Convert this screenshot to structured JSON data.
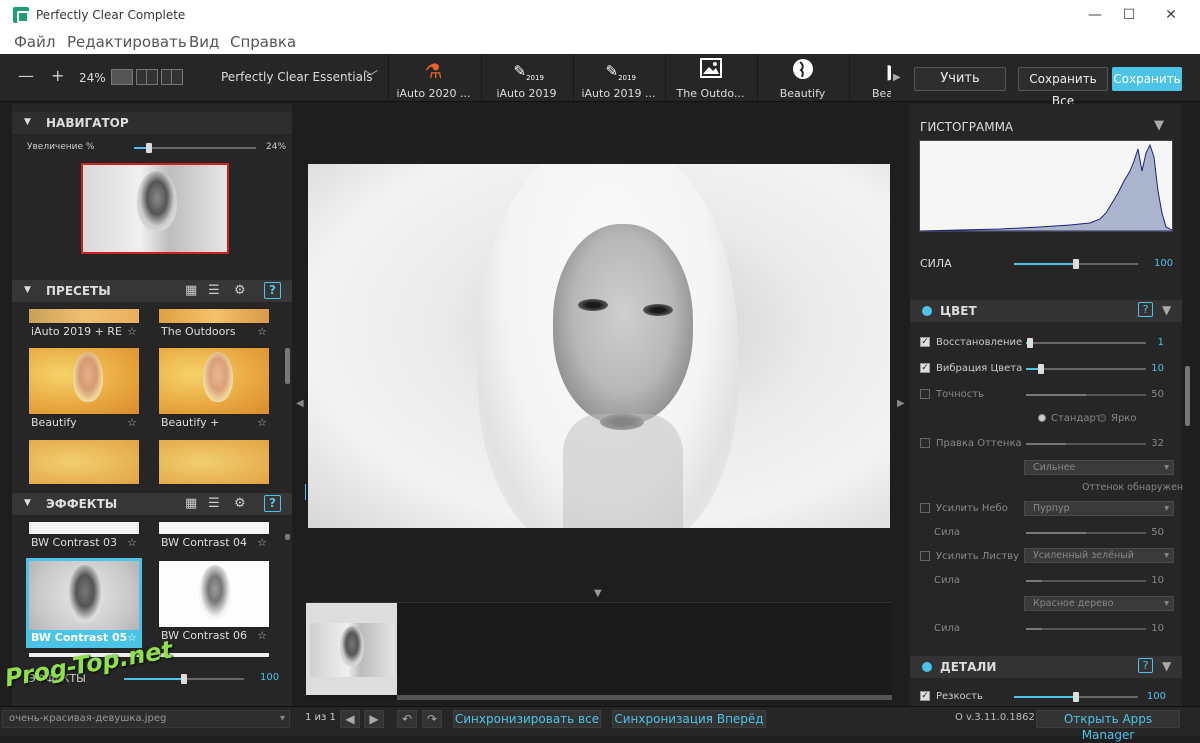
{
  "window": {
    "title": "Perfectly Clear Complete"
  },
  "menu": [
    "Файл",
    "Редактировать",
    "Вид",
    "Справка"
  ],
  "toolbar": {
    "zoom": "24%",
    "preset_group": "Perfectly Clear Essentials",
    "preset_tabs": [
      "iAuto 2020 ...",
      "iAuto 2019",
      "iAuto 2019 ...",
      "The Outdo...",
      "Beautify",
      "Beau"
    ],
    "tab_badge": "2019",
    "learn": "Учить",
    "save_all": "Сохранить Все",
    "save": "Сохранить"
  },
  "navigator": {
    "title": "НАВИГАТОР",
    "zoom_label": "Увеличение %",
    "zoom_value": "24%",
    "zoom_fraction": 0.12
  },
  "presets": {
    "title": "ПРЕСЕТЫ",
    "items": [
      "iAuto 2019 + RE",
      "The Outdoors",
      "Beautify",
      "Beautify +"
    ]
  },
  "effects": {
    "title": "ЭФФЕКТЫ",
    "items": [
      "BW Contrast 03",
      "BW Contrast 04",
      "BW Contrast 05",
      "BW Contrast 06"
    ],
    "strength_label": "ЭФФЕКТЫ",
    "strength_value": "100",
    "strength_fraction": 0.5
  },
  "histogram": {
    "title": "ГИСТОГРАММА",
    "strength_label": "СИЛА",
    "strength_value": "100",
    "strength_fraction": 0.5
  },
  "color": {
    "title": "ЦВЕТ",
    "restore_label": "Восстановление",
    "restore_value": "1",
    "vibrance_label": "Вибрация Цвета",
    "vibrance_value": "10",
    "accuracy_label": "Точность",
    "accuracy_value": "50",
    "radio_standard": "Стандарт",
    "radio_bright": "Ярко",
    "tint_label": "Правка Оттенка",
    "tint_value": "32",
    "tint_dd": "Сильнее",
    "tint_detected": "Оттенок обнаружен",
    "sky_label": "Усилить Небо",
    "sky_dd": "Пурпур",
    "sky_strength_label": "Сила",
    "sky_strength_value": "50",
    "foliage_label": "Усилить Листву",
    "foliage_dd": "Усиленный зелёный",
    "foliage_strength_label": "Сила",
    "foliage_strength_value": "10",
    "wood_dd": "Красное дерево",
    "wood_strength_label": "Сила",
    "wood_strength_value": "10"
  },
  "details": {
    "title": "ДЕТАЛИ",
    "sharpness_label": "Резкость",
    "sharpness_value": "100"
  },
  "status": {
    "filename": "очень-красивая-девушка.jpeg",
    "page": "1 из 1",
    "sync_all": "Синхронизировать все",
    "sync_forward": "Синхронизация Вперёд",
    "version": "О v.3.11.0.1862",
    "apps_manager": "Открыть Apps Manager"
  },
  "watermark": "Prog-Top.net",
  "colors": {
    "accent": "#4cc4e8",
    "selected_border": "#4cc4e8",
    "navigator_frame": "#cc2222"
  }
}
